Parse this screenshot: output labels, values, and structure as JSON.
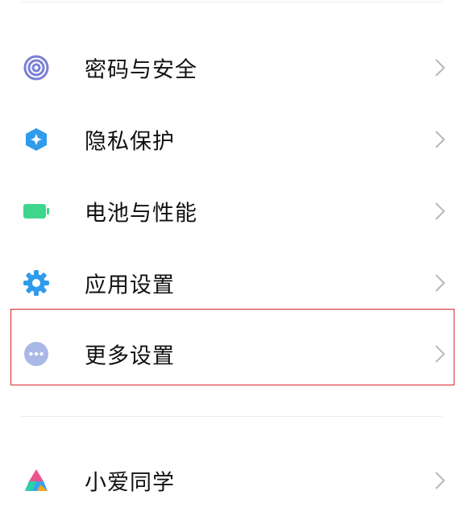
{
  "settings": {
    "items": [
      {
        "label": "密码与安全",
        "icon": "fingerprint-icon",
        "color": "#7a80d6"
      },
      {
        "label": "隐私保护",
        "icon": "privacy-shield-icon",
        "color": "#2f9bea"
      },
      {
        "label": "电池与性能",
        "icon": "battery-icon",
        "color": "#3dd68c"
      },
      {
        "label": "应用设置",
        "icon": "gear-icon",
        "color": "#2f9bea"
      },
      {
        "label": "更多设置",
        "icon": "more-dots-icon",
        "color": "#a9b8e6"
      },
      {
        "label": "小爱同学",
        "icon": "xiaoai-icon",
        "color": "#e9548a"
      }
    ],
    "highlighted_item": "更多设置",
    "highlight_color": "#d9262c"
  }
}
